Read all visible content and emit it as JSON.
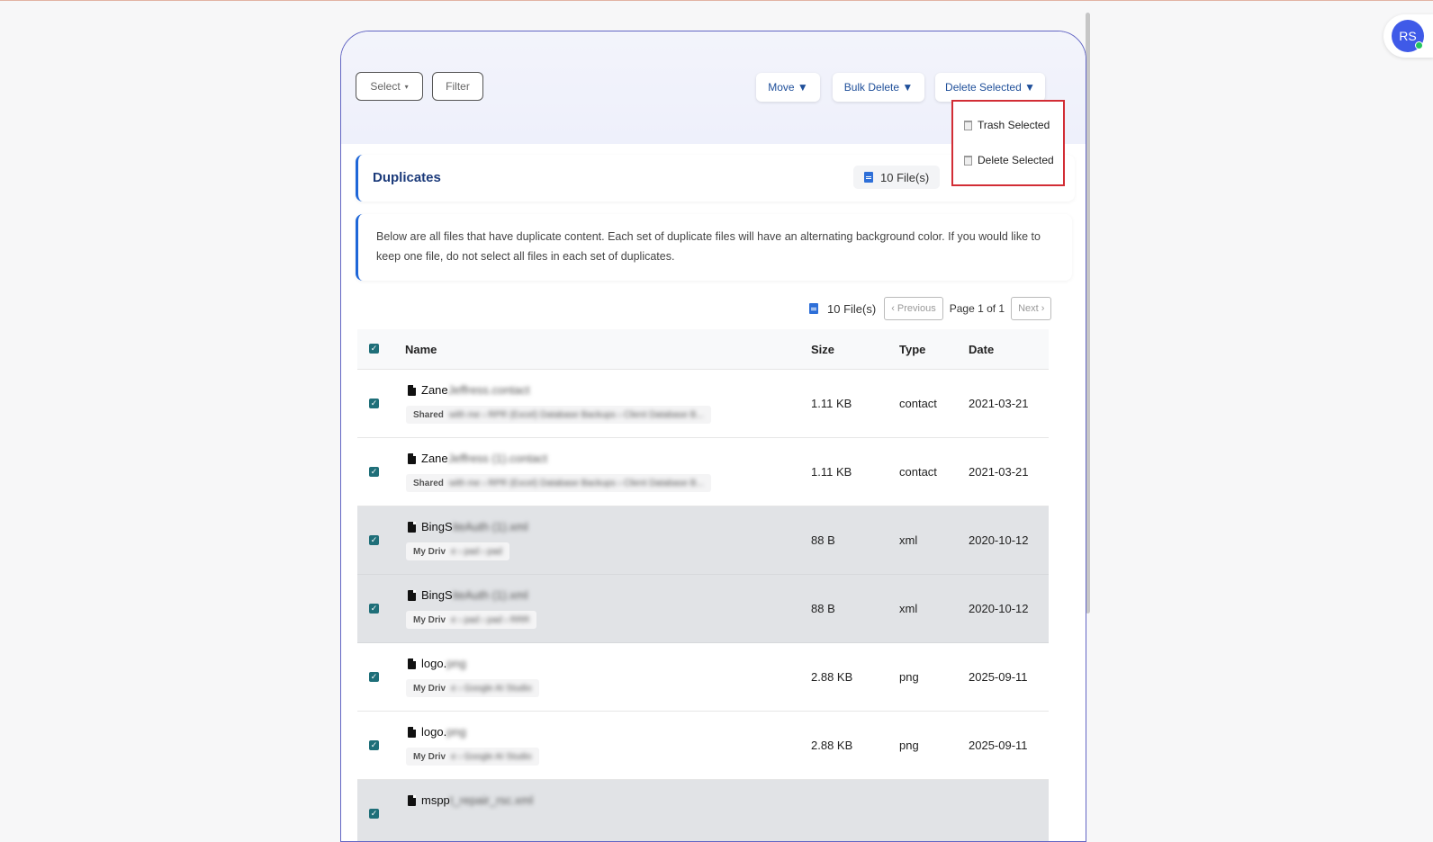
{
  "avatar": {
    "initials": "RS"
  },
  "toolbar": {
    "select_label": "Select",
    "filter_label": "Filter",
    "move_label": "Move ▼",
    "bulk_delete_label": "Bulk Delete ▼",
    "delete_selected_label": "Delete Selected ▼"
  },
  "dropdown": {
    "items": [
      {
        "label": "Trash Selected"
      },
      {
        "label": "Delete Selected"
      }
    ]
  },
  "duplicates": {
    "title": "Duplicates",
    "file_count": "10 File(s)",
    "info": "Below are all files that have duplicate content. Each set of duplicate files will have an alternating background color. If you would like to keep one file, do not select all files in each set of duplicates."
  },
  "pagination": {
    "file_count": "10 File(s)",
    "previous_label": "‹ Previous",
    "page_label": "Page 1 of 1",
    "next_label": "Next ›"
  },
  "table": {
    "columns": {
      "name": "Name",
      "size": "Size",
      "type": "Type",
      "date": "Date"
    },
    "rows": [
      {
        "name": "Zane",
        "name_hidden": "Jeffress.contact",
        "location": "Shared",
        "location_hidden": "with me › RPR (Excel) Database Backups › Client Database B...",
        "size": "1.11 KB",
        "type": "contact",
        "date": "2021-03-21",
        "alt": false
      },
      {
        "name": "Zane",
        "name_hidden": "Jeffress (1).contact",
        "location": "Shared",
        "location_hidden": "with me › RPR (Excel) Database Backups › Client Database B...",
        "size": "1.11 KB",
        "type": "contact",
        "date": "2021-03-21",
        "alt": false
      },
      {
        "name": "BingS",
        "name_hidden": "iteAuth (1).xml",
        "location": "My Driv",
        "location_hidden": "e › pad › pad",
        "size": "88 B",
        "type": "xml",
        "date": "2020-10-12",
        "alt": true
      },
      {
        "name": "BingS",
        "name_hidden": "iteAuth (1).xml",
        "location": "My Driv",
        "location_hidden": "e › pad › pad › RRR",
        "size": "88 B",
        "type": "xml",
        "date": "2020-10-12",
        "alt": true
      },
      {
        "name": "logo.",
        "name_hidden": "png",
        "location": "My Driv",
        "location_hidden": "e › Google AI Studio",
        "size": "2.88 KB",
        "type": "png",
        "date": "2025-09-11",
        "alt": false
      },
      {
        "name": "logo.",
        "name_hidden": "png",
        "location": "My Driv",
        "location_hidden": "e › Google AI Studio",
        "size": "2.88 KB",
        "type": "png",
        "date": "2025-09-11",
        "alt": false
      },
      {
        "name": "mspp",
        "name_hidden": "t_repair_rsc.xml",
        "location": "",
        "location_hidden": "",
        "size": "",
        "type": "",
        "date": "",
        "alt": true
      }
    ]
  }
}
